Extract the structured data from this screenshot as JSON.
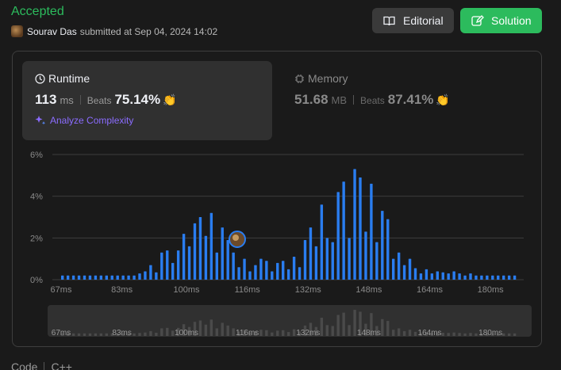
{
  "status": "Accepted",
  "submitter": {
    "name": "Sourav Das",
    "submitted_text": "submitted at Sep 04, 2024 14:02"
  },
  "buttons": {
    "editorial": "Editorial",
    "solution": "Solution"
  },
  "runtime": {
    "label": "Runtime",
    "value": "113",
    "unit": "ms",
    "beats_label": "Beats",
    "beats_pct": "75.14%",
    "clap": "👏"
  },
  "memory": {
    "label": "Memory",
    "value": "51.68",
    "unit": "MB",
    "beats_label": "Beats",
    "beats_pct": "87.41%",
    "clap": "👏"
  },
  "analyze_label": "Analyze Complexity",
  "footer": {
    "code_label": "Code",
    "lang": "C++"
  },
  "colors": {
    "accent_green": "#2cbb5d",
    "bar_blue": "#2a7df0",
    "analyze_purple": "#8b6cff"
  },
  "chart_data": {
    "type": "bar",
    "y_ticks": [
      "6%",
      "4%",
      "2%",
      "0%"
    ],
    "ylim": [
      0,
      6
    ],
    "x_tick_labels": [
      "67ms",
      "83ms",
      "100ms",
      "116ms",
      "132ms",
      "148ms",
      "164ms",
      "180ms"
    ],
    "x_tick_values": [
      67,
      83,
      100,
      116,
      132,
      148,
      164,
      180
    ],
    "x_range": [
      67,
      186
    ],
    "grid": true,
    "highlight_value": 113,
    "values": [
      0.2,
      0.2,
      0.2,
      0.2,
      0.2,
      0.2,
      0.2,
      0.2,
      0.2,
      0.2,
      0.2,
      0.2,
      0.2,
      0.2,
      0.3,
      0.4,
      0.7,
      0.35,
      1.3,
      1.4,
      0.8,
      1.4,
      2.2,
      1.6,
      2.7,
      3.0,
      2.1,
      3.2,
      1.3,
      2.5,
      1.9,
      1.3,
      0.6,
      1.0,
      0.4,
      0.7,
      1.0,
      0.9,
      0.4,
      0.8,
      0.9,
      0.5,
      1.1,
      0.6,
      1.9,
      2.5,
      1.6,
      3.6,
      2.0,
      1.8,
      4.2,
      4.7,
      2.0,
      5.3,
      4.9,
      2.3,
      4.6,
      1.8,
      3.3,
      2.9,
      1.0,
      1.3,
      0.7,
      1.0,
      0.55,
      0.3,
      0.5,
      0.3,
      0.4,
      0.35,
      0.3,
      0.4,
      0.3,
      0.2,
      0.3,
      0.2,
      0.2,
      0.2,
      0.2,
      0.2,
      0.2,
      0.2,
      0.2
    ]
  }
}
